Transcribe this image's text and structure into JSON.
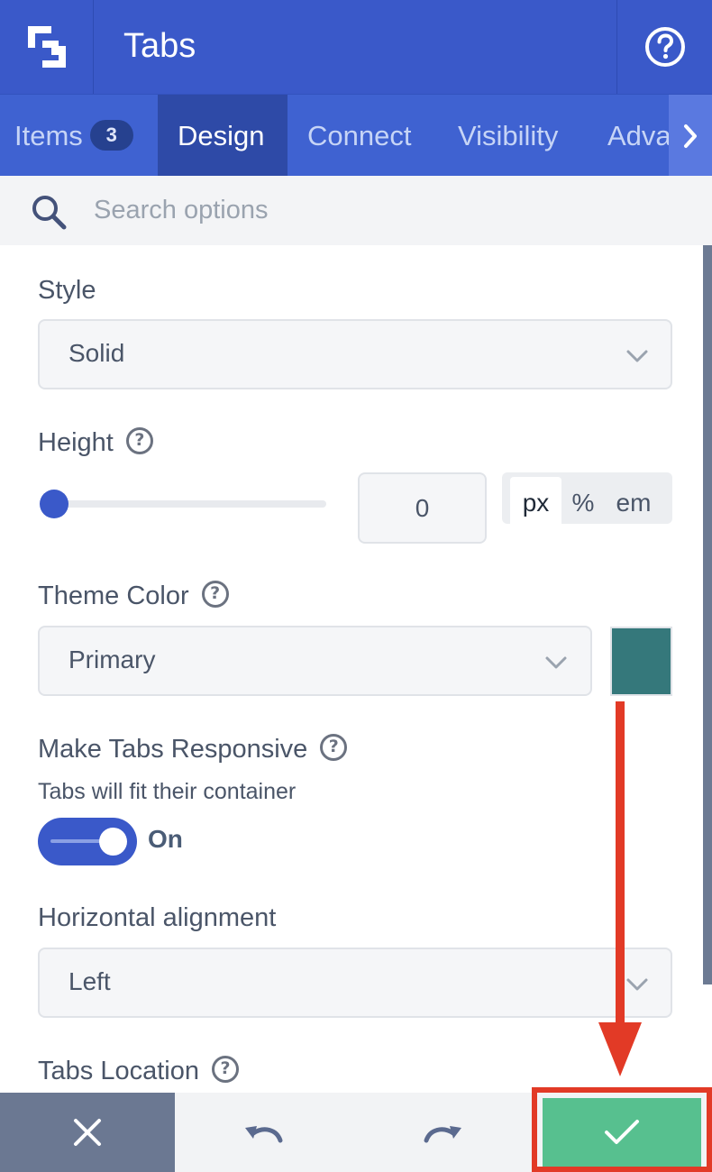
{
  "header": {
    "title": "Tabs",
    "logo_icon": "brand-logo-icon",
    "help_icon": "help-circle-icon"
  },
  "tabs": {
    "items": [
      {
        "label": "Items",
        "badge": "3"
      },
      {
        "label": "Design",
        "active": true
      },
      {
        "label": "Connect"
      },
      {
        "label": "Visibility"
      },
      {
        "label": "Adva"
      }
    ],
    "next_icon": "chevron-right-icon"
  },
  "search": {
    "placeholder": "Search options",
    "icon": "search-icon"
  },
  "fields": {
    "style": {
      "label": "Style",
      "value": "Solid"
    },
    "height": {
      "label": "Height",
      "value": "0",
      "units": [
        "px",
        "%",
        "em"
      ],
      "selected_unit": "px",
      "slider_value": 0
    },
    "theme_color": {
      "label": "Theme Color",
      "value": "Primary",
      "swatch_color": "#35787b"
    },
    "responsive": {
      "label": "Make Tabs Responsive",
      "description": "Tabs will fit their container",
      "toggle_label": "On",
      "toggle_on": true
    },
    "horizontal_alignment": {
      "label": "Horizontal alignment",
      "value": "Left"
    },
    "tabs_location": {
      "label": "Tabs Location"
    }
  },
  "footer": {
    "cancel_icon": "close-icon",
    "undo_icon": "undo-icon",
    "redo_icon": "redo-icon",
    "save_icon": "check-icon"
  },
  "colors": {
    "header_bg": "#3a59c9",
    "tabs_bg": "#3f62d1",
    "active_tab_bg": "#2e4aa7",
    "save_bg": "#57c08f",
    "annotation_red": "#e23a26"
  }
}
